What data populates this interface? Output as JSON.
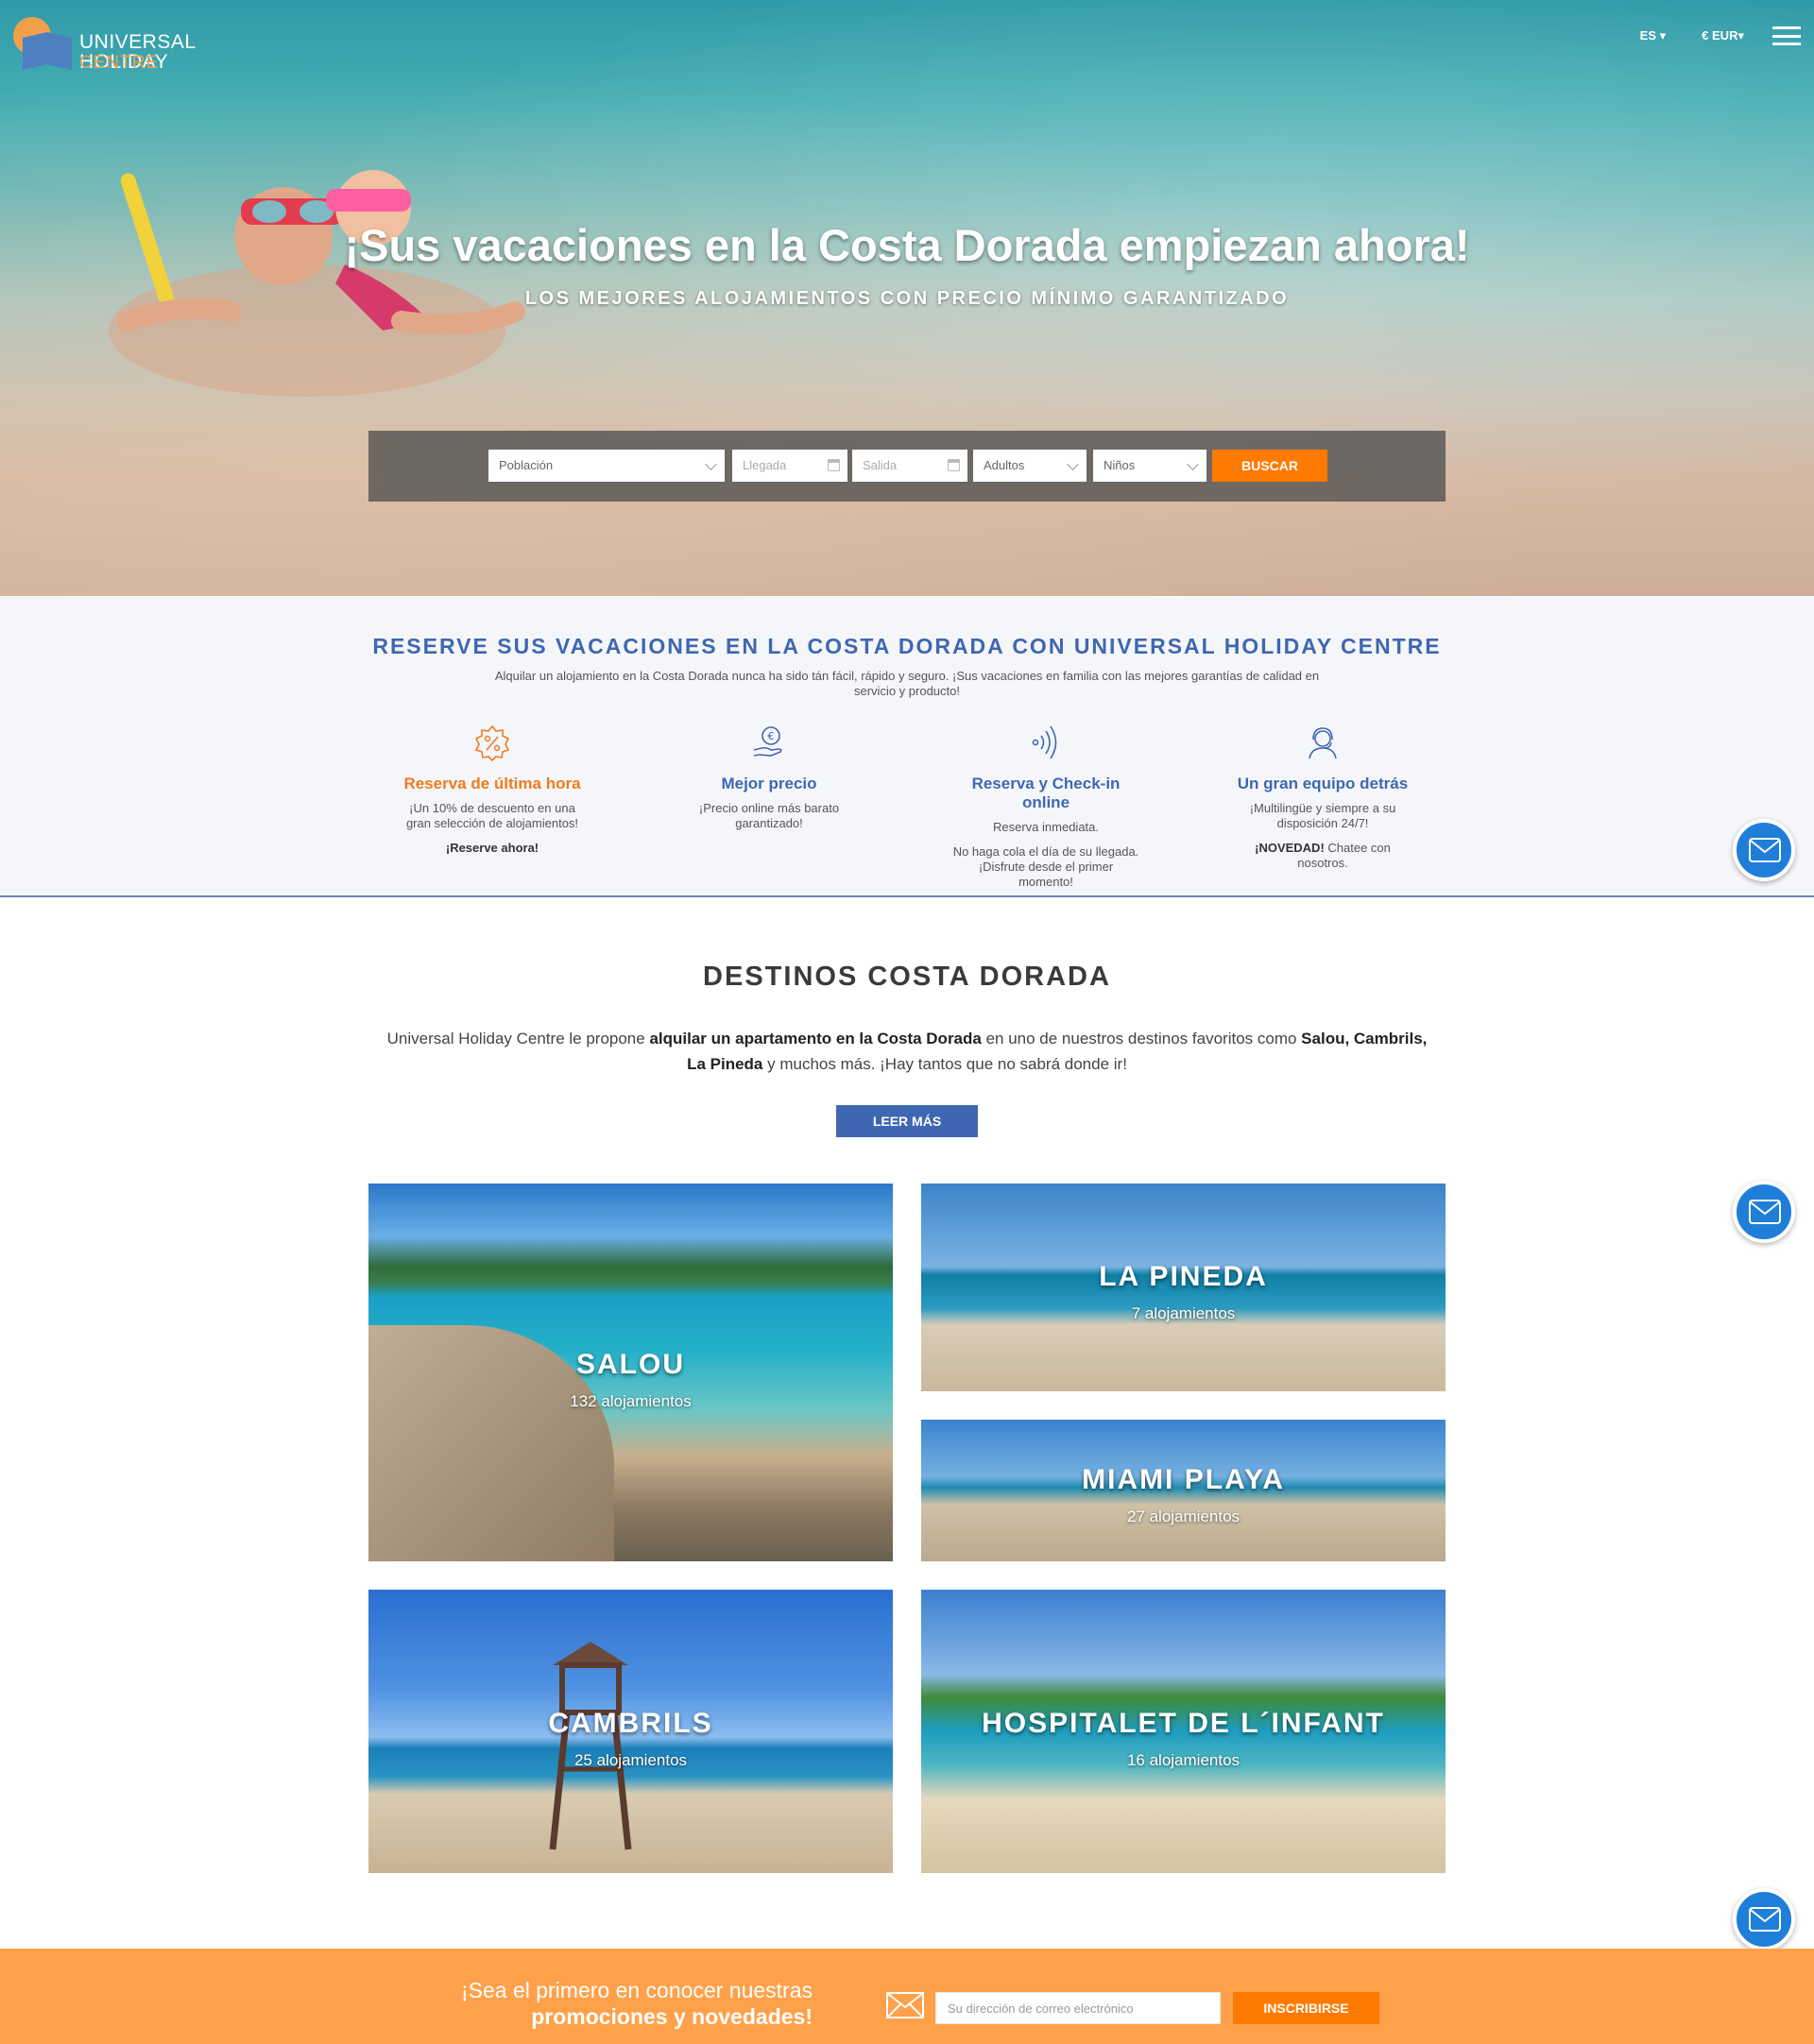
{
  "header": {
    "logo_line1": "UNIVERSAL HOLIDAY",
    "logo_line2": "CENTRE",
    "language": "ES",
    "currency": "€ EUR"
  },
  "hero": {
    "title": "¡Sus vacaciones en la Costa Dorada empiezan ahora!",
    "subtitle": "LOS MEJORES ALOJAMIENTOS CON PRECIO MÍNIMO GARANTIZADO"
  },
  "search": {
    "poblacion": "Población",
    "llegada": "Llegada",
    "salida": "Salida",
    "adultos": "Adultos",
    "ninos": "Niños",
    "button": "BUSCAR"
  },
  "features": {
    "title": "RESERVE SUS VACACIONES EN LA COSTA DORADA CON UNIVERSAL HOLIDAY CENTRE",
    "description": "Alquilar un alojamiento en la Costa Dorada nunca ha sido tán fácil, rápido y seguro. ¡Sus vacaciones en familia con las mejores garantías de calidad en servicio y producto!",
    "items": [
      {
        "title": "Reserva de última hora",
        "color": "#f07b1e",
        "text": "¡Un 10% de descuento en una gran selección de alojamientos!",
        "extra": "¡Reserve ahora!",
        "icon": "discount-badge-icon"
      },
      {
        "title": "Mejor precio",
        "color": "#3f67b1",
        "text": "¡Precio online más barato garantizado!",
        "icon": "euro-hand-icon"
      },
      {
        "title": "Reserva y Check-in online",
        "color": "#3f67b1",
        "text": "Reserva inmediata.",
        "text2": "No haga cola el día de su llegada. ¡Disfrute desde el primer momento!",
        "icon": "contactless-icon"
      },
      {
        "title": "Un gran equipo detrás",
        "color": "#3f67b1",
        "text": "¡Multilingüe y siempre a su disposición 24/7!",
        "extra_bold": "¡NOVEDAD!",
        "extra_rest": " Chatee con nosotros.",
        "icon": "support-agent-icon"
      }
    ]
  },
  "destinos": {
    "title": "DESTINOS COSTA DORADA",
    "text_1": "Universal Holiday Centre le propone ",
    "text_2": "alquilar un apartamento en la Costa Dorada",
    "text_3": " en uno de nuestros destinos favoritos como ",
    "text_4": "Salou, Cambrils,",
    "text_5": "La Pineda",
    "text_6": " y muchos más. ¡Hay tantos que no sabrá donde ir!",
    "button": "LEER MÁS",
    "cards": [
      {
        "name": "SALOU",
        "count": "132 alojamientos"
      },
      {
        "name": "LA PINEDA",
        "count": "7 alojamientos"
      },
      {
        "name": "MIAMI PLAYA",
        "count": "27 alojamientos"
      },
      {
        "name": "CAMBRILS",
        "count": "25 alojamientos"
      },
      {
        "name": "HOSPITALET DE L´INFANT",
        "count": "16 alojamientos"
      }
    ]
  },
  "newsletter": {
    "line1": "¡Sea el primero en conocer nuestras",
    "line2": "promociones y novedades!",
    "placeholder": "Su dirección de correo electrónico",
    "button": "INSCRIBIRSE"
  }
}
